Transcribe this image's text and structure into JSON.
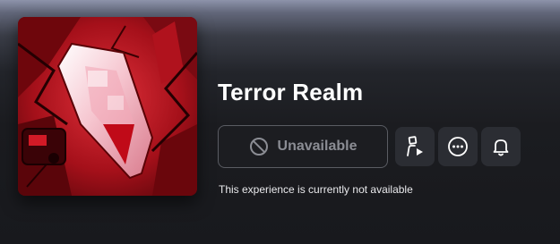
{
  "game": {
    "title": "Terror Realm",
    "thumbnail_icon": "experience-thumbnail-image"
  },
  "actions": {
    "play_label": "Unavailable",
    "play_icon": "prohibited-icon",
    "avatar_icon": "avatar-play-icon",
    "more_icon": "more-options-icon",
    "notify_icon": "bell-icon"
  },
  "status": {
    "message": "This experience is currently not available"
  },
  "colors": {
    "accent_red": "#c8101c",
    "button_bg": "#2b2d33",
    "disabled_text": "#8b8d94"
  }
}
